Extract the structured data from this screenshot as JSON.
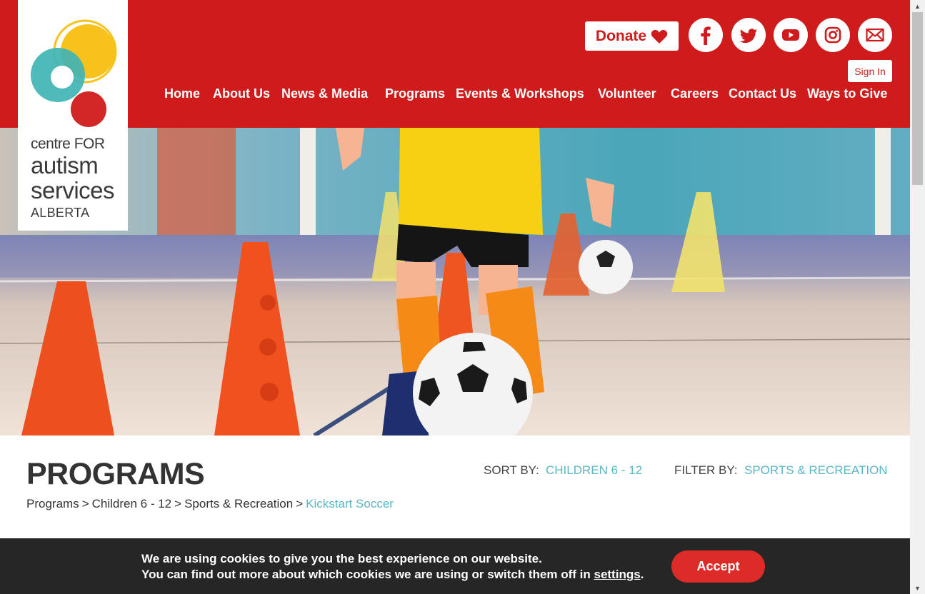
{
  "brand": {
    "logo_line1": "centre FOR",
    "logo_line2": "autism",
    "logo_line3": "services",
    "logo_line4": "ALBERTA",
    "primary_color": "#cf1b1b",
    "accent_color": "#5bb8c4"
  },
  "header": {
    "donate_label": "Donate",
    "donate_icon": "heart-icon",
    "social": [
      {
        "name": "facebook",
        "icon": "facebook-icon"
      },
      {
        "name": "twitter",
        "icon": "twitter-icon"
      },
      {
        "name": "youtube",
        "icon": "youtube-icon"
      },
      {
        "name": "instagram",
        "icon": "instagram-icon"
      },
      {
        "name": "email",
        "icon": "mail-icon"
      }
    ],
    "signin_label": "Sign In"
  },
  "nav": {
    "items": [
      {
        "label": "Home"
      },
      {
        "label": "About Us"
      },
      {
        "label": "News & Media"
      },
      {
        "label": "Programs"
      },
      {
        "label": "Events & Workshops"
      },
      {
        "label": "Volunteer"
      },
      {
        "label": "Careers"
      },
      {
        "label": "Contact Us"
      },
      {
        "label": "Ways to Give"
      }
    ]
  },
  "hero": {
    "image_subject": "child dribbling soccer ball between cones in gym"
  },
  "programs": {
    "title": "PROGRAMS",
    "sort_label": "SORT BY:",
    "sort_value": "CHILDREN 6 - 12",
    "filter_label": "FILTER BY:",
    "filter_value": "SPORTS & RECREATION",
    "breadcrumb": {
      "items": [
        "Programs",
        "Children 6 - 12",
        "Sports & Recreation"
      ],
      "separator": ">",
      "current": "Kickstart Soccer"
    }
  },
  "cookie": {
    "line1": "We are using cookies to give you the best experience on our website.",
    "line2_prefix": "You can find out more about which cookies we are using or switch them off in ",
    "link_label": "settings",
    "line2_suffix": ".",
    "accept_label": "Accept"
  }
}
